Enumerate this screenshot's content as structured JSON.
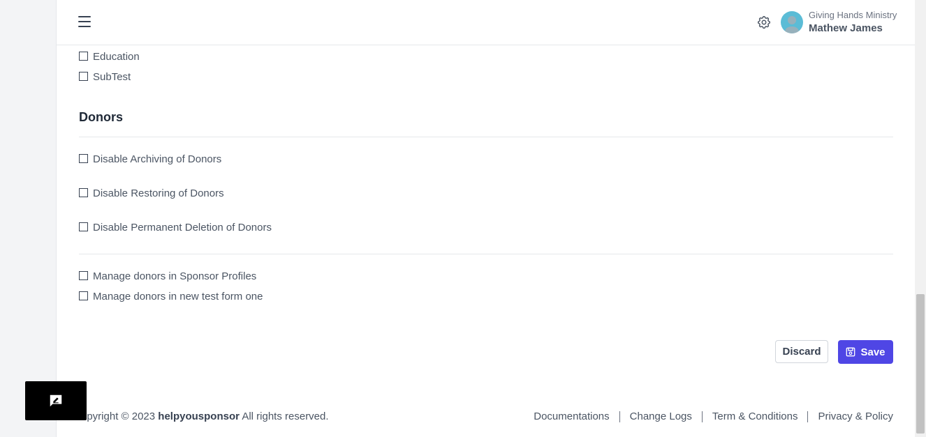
{
  "header": {
    "org_name": "Giving Hands Ministry",
    "user_name": "Mathew James"
  },
  "categories": [
    {
      "label": "Education"
    },
    {
      "label": "SubTest"
    }
  ],
  "donors_section": {
    "title": "Donors",
    "options": [
      {
        "label": "Disable Archiving of Donors",
        "checked": false
      },
      {
        "label": "Disable Restoring of Donors",
        "checked": false
      },
      {
        "label": "Disable Permanent Deletion of Donors",
        "checked": false
      }
    ],
    "manage_options": [
      {
        "label": "Manage donors in Sponsor Profiles",
        "checked": false
      },
      {
        "label": "Manage donors in new test form one",
        "checked": false
      }
    ]
  },
  "actions": {
    "discard_label": "Discard",
    "save_label": "Save"
  },
  "footer": {
    "copyright_prefix": "opyright © 2023 ",
    "brand": "helpyousponsor",
    "copyright_suffix": " All rights reserved.",
    "links": [
      "Documentations",
      "Change Logs",
      "Term & Conditions",
      "Privacy & Policy"
    ]
  },
  "colors": {
    "primary": "#4f46e5",
    "avatar_bg": "#5bbcd6"
  }
}
